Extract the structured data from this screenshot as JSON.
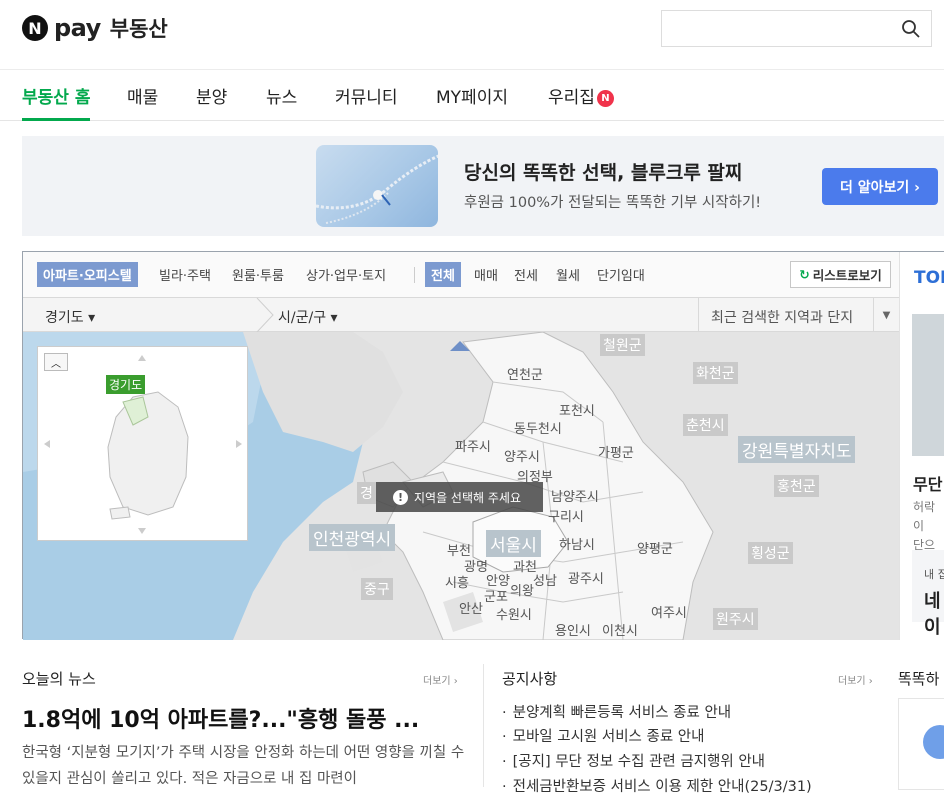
{
  "header": {
    "logo_letter": "N",
    "logo_pay": "pay",
    "logo_title": "부동산",
    "search_placeholder": ""
  },
  "nav": {
    "items": [
      "부동산 홈",
      "매물",
      "분양",
      "뉴스",
      "커뮤니티",
      "MY페이지",
      "우리집"
    ],
    "badge": "N",
    "active_color": "#03a94d"
  },
  "banner": {
    "title": "당신의 똑똑한 선택, 블루크루 팔찌",
    "subtitle": "후원금 100%가 전달되는 똑똑한 기부 시작하기!",
    "button": "더 알아보기 ›"
  },
  "map": {
    "toolbar": {
      "property_types": [
        "아파트·오피스텔",
        "빌라·주택",
        "원룸·투룸",
        "상가·업무·토지"
      ],
      "deal_types": [
        "전체",
        "매매",
        "전세",
        "월세",
        "단기임대"
      ],
      "list_button": "리스트로보기"
    },
    "region": {
      "province": "경기도 ▾",
      "city": "시/군/구 ▾",
      "recent": "최근 검색한 지역과 단지",
      "recent_arrow": "▼"
    },
    "mini_map_tag": "경기도",
    "tooltip": "지역을 선택해 주세요",
    "labels": {
      "cheolwon": "철원군",
      "hwacheon": "화천군",
      "yeoncheon": "연천군",
      "pocheon": "포천시",
      "chuncheon": "춘천시",
      "dongducheon": "동두천시",
      "paju": "파주시",
      "gapyeong": "가평군",
      "gangwon": "강원특별자치도",
      "yangju": "양주시",
      "uijeongbu": "의정부",
      "hongcheon": "홍천군",
      "gyeong": "경",
      "namyangju": "남양주시",
      "guri": "구리시",
      "incheon": "인천광역시",
      "seoul": "서울시",
      "hanam": "하남시",
      "yangpyeong": "양평군",
      "hoengseong": "횡성군",
      "bucheon": "부천",
      "gwangmyeong": "광명",
      "gwacheon": "과천",
      "siheung": "시흥",
      "anyang": "안양",
      "seongnam": "성남",
      "gwangju": "광주시",
      "gunpo": "군포",
      "uiwang": "의왕",
      "junggu": "중구",
      "ansan": "안산",
      "suwon": "수원시",
      "yeoju": "여주시",
      "wonju": "원주시",
      "yongin": "용인시",
      "icheon": "이천시"
    },
    "side": {
      "tab": "TOD",
      "title": "무단",
      "desc1": "허락이",
      "desc2": "단으로",
      "box_a": "내 집",
      "box_b": "네이"
    }
  },
  "news": {
    "title": "오늘의 뉴스",
    "more": "더보기 ›",
    "headline": "1.8억에 10억 아파트를?...\"흥행 돌풍 ...",
    "desc": "한국형 ‘지분형 모기지’가 주택 시장을 안정화 하는데 어떤 영향을 끼칠 수 있을지 관심이 쏠리고 있다. 적은 자금으로 내 집 마련이"
  },
  "notice": {
    "title": "공지사항",
    "more": "더보기 ›",
    "items": [
      "분양계획 빠른등록 서비스 종료 안내",
      "모바일 고시원 서비스 종료 안내",
      "[공지] 무단 정보 수집 관련 금지행위 안내",
      "전세금반환보증 서비스 이용 제한 안내(25/3/31)"
    ]
  },
  "right_section": {
    "title": "똑똑하"
  }
}
